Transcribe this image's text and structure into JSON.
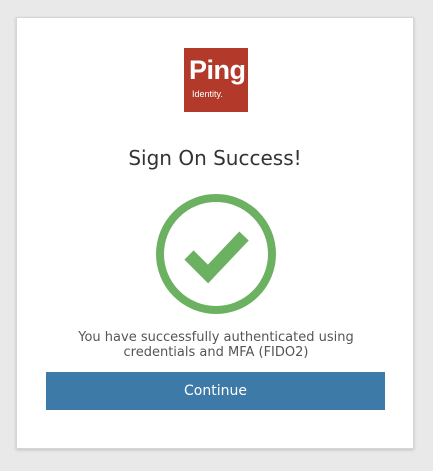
{
  "logo": {
    "word": "Ping",
    "subtext": "Identity.",
    "background_color": "#b33a2a"
  },
  "title": "Sign On Success!",
  "success_icon": {
    "name": "check-circle-icon",
    "color": "#6cb062"
  },
  "message": {
    "line1": "You have successfully authenticated using",
    "line2": "credentials and MFA (FIDO2)"
  },
  "continue_button": {
    "label": "Continue",
    "color": "#3e7aa8"
  }
}
